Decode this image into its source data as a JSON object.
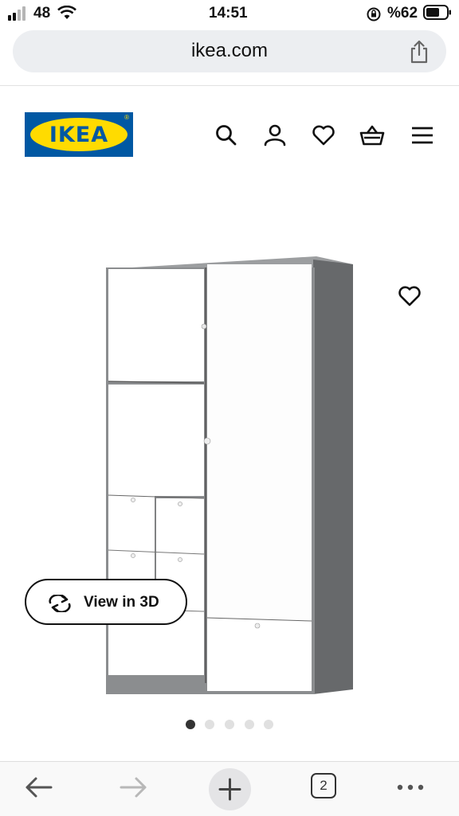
{
  "status_bar": {
    "signal": "48",
    "time": "14:51",
    "battery": "%62"
  },
  "browser": {
    "url": "ikea.com",
    "tab_count": "2"
  },
  "ikea": {
    "logo_text": "IKEA",
    "registered": "®"
  },
  "header_icons": [
    "search-icon",
    "account-icon",
    "heart-icon",
    "basket-icon",
    "menu-icon"
  ],
  "product": {
    "view_3d_label": "View in 3D",
    "image_count": 5,
    "active_image": 1
  },
  "colors": {
    "ikea_blue": "#0058a3",
    "ikea_yellow": "#ffdb00",
    "wardrobe_frame": "#5f6163",
    "wardrobe_door": "#ffffff"
  }
}
